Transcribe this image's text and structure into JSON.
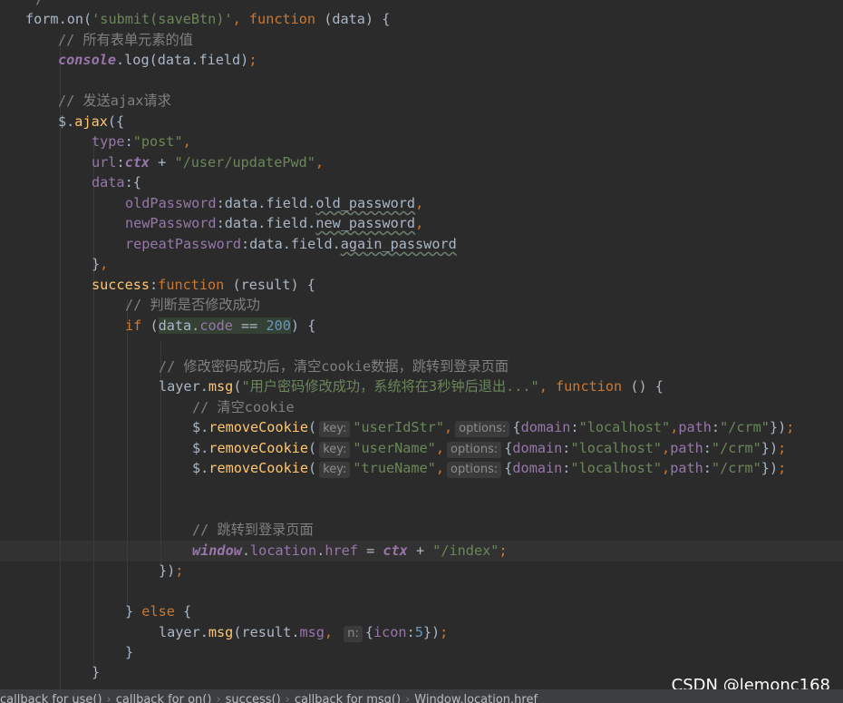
{
  "code": {
    "l0": "*/",
    "l1": {
      "a": "form.on(",
      "b": "'submit(saveBtn)'",
      "c": ", ",
      "d": "function",
      "e": " (data) {"
    },
    "l2": "// 所有表单元素的值",
    "l3": {
      "a": "console",
      "b": ".log(data.field)",
      "c": ";"
    },
    "l5": "// 发送ajax请求",
    "l6": {
      "a": "$.",
      "b": "ajax",
      "c": "({"
    },
    "l7": {
      "a": "type",
      "b": ":",
      "c": "\"post\"",
      "d": ","
    },
    "l8": {
      "a": "url",
      "b": ":",
      "c": "ctx",
      "d": " + ",
      "e": "\"/user/updatePwd\"",
      "f": ","
    },
    "l9": {
      "a": "data",
      "b": ":{"
    },
    "l10": {
      "a": "oldPassword",
      "b": ":data.field.",
      "c": "old_password",
      "d": ","
    },
    "l11": {
      "a": "newPassword",
      "b": ":data.field.",
      "c": "new_password",
      "d": ","
    },
    "l12": {
      "a": "repeatPassword",
      "b": ":data.field.",
      "c": "again_password"
    },
    "l13": {
      "a": "}",
      "b": ","
    },
    "l14": {
      "a": "success",
      "b": ":",
      "c": "function",
      "d": " (result) {"
    },
    "l15": "// 判断是否修改成功",
    "l16": {
      "a": "if",
      "b": " (",
      "c": "data.",
      "d": "code",
      "e": " == ",
      "f": "200",
      "g": ") {"
    },
    "l18": "// 修改密码成功后，清空cookie数据，跳转到登录页面",
    "l19": {
      "a": "layer.",
      "b": "msg",
      "c": "(",
      "d": "\"用户密码修改成功，系统将在3秒钟后退出...\"",
      "e": ", ",
      "f": "function",
      "g": " () {"
    },
    "l20": "// 清空cookie",
    "l21": {
      "a": "$.",
      "b": "removeCookie",
      "c": "(",
      "h1": "key:",
      "d": "\"userIdStr\"",
      "e": ",",
      "h2": "options:",
      "f1": "{",
      "f2": "domain",
      "f3": ":",
      "f4": "\"localhost\"",
      "f5": ",",
      "f6": "path",
      "f7": ":",
      "f8": "\"/crm\"",
      "f9": "})",
      "f10": ";"
    },
    "l22": {
      "a": "$.",
      "b": "removeCookie",
      "c": "(",
      "h1": "key:",
      "d": "\"userName\"",
      "e": ",",
      "h2": "options:",
      "f1": "{",
      "f2": "domain",
      "f3": ":",
      "f4": "\"localhost\"",
      "f5": ",",
      "f6": "path",
      "f7": ":",
      "f8": "\"/crm\"",
      "f9": "})",
      "f10": ";"
    },
    "l23": {
      "a": "$.",
      "b": "removeCookie",
      "c": "(",
      "h1": "key:",
      "d": "\"trueName\"",
      "e": ",",
      "h2": "options:",
      "f1": "{",
      "f2": "domain",
      "f3": ":",
      "f4": "\"localhost\"",
      "f5": ",",
      "f6": "path",
      "f7": ":",
      "f8": "\"/crm\"",
      "f9": "})",
      "f10": ";"
    },
    "l26": "// 跳转到登录页面",
    "l27": {
      "a": "window",
      "b": ".",
      "c": "location",
      "d": ".",
      "e": "href",
      "f": " = ",
      "g": "ctx",
      "h": " + ",
      "i": "\"/index\"",
      "j": ";"
    },
    "l28": {
      "a": "})",
      "b": ";"
    },
    "l30": {
      "a": "} ",
      "b": "else",
      "c": " {"
    },
    "l31": {
      "a": "layer.",
      "b": "msg",
      "c": "(result.",
      "d": "msg",
      "e": ", ",
      "h": "n:",
      "f": "{",
      "g": "icon",
      "i": ":",
      "j": "5",
      "k": "})",
      "l": ";"
    },
    "l32": "}",
    "l33": "}"
  },
  "breadcrumb": [
    "callback for use()",
    "callback for on()",
    "success()",
    "callback for msg()",
    "Window.location.href"
  ],
  "watermark": "CSDN @lemonc168",
  "colors": {
    "background": "#2b2b2b",
    "keyword": "#cc7832",
    "string": "#6a8759",
    "number": "#6897bb",
    "comment": "#808080",
    "function": "#ffc66d",
    "property": "#9876aa",
    "text": "#a9b7c6"
  }
}
